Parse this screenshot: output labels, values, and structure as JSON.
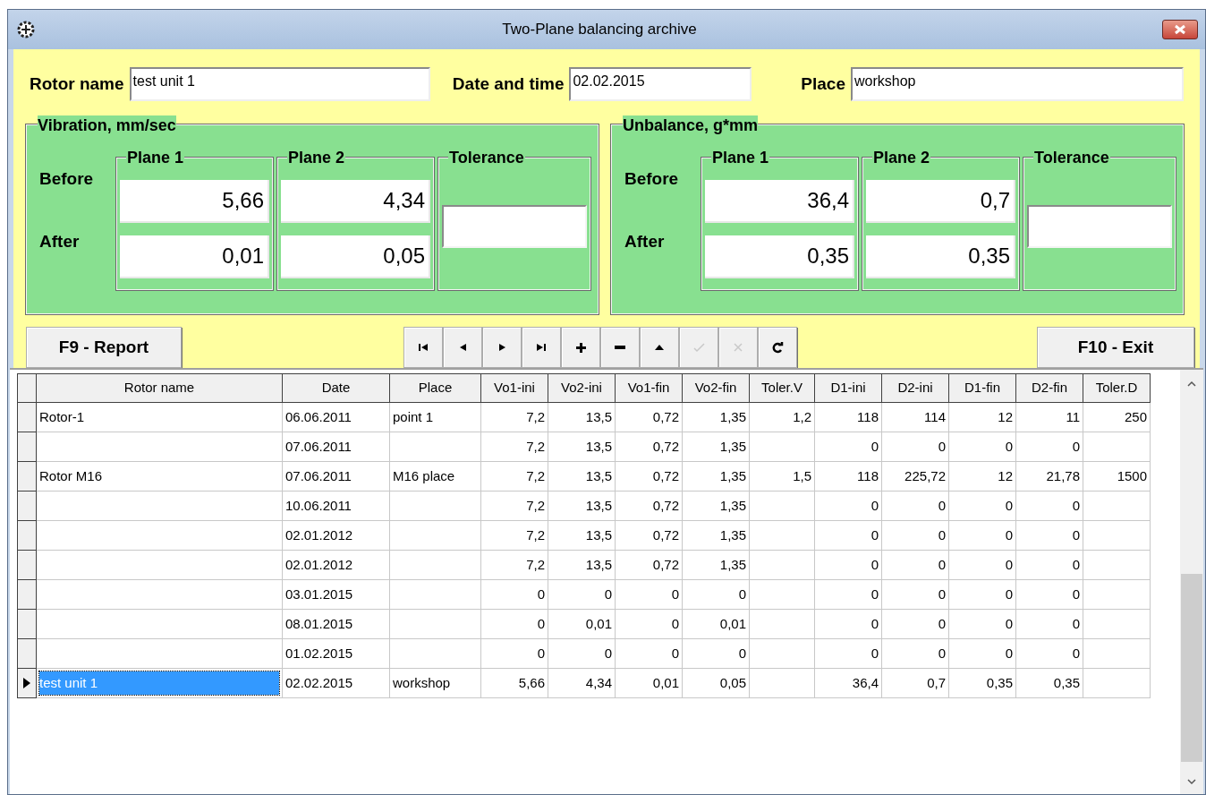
{
  "window": {
    "title": "Two-Plane balancing archive"
  },
  "header_fields": [
    {
      "label": "Rotor name",
      "value": "test unit 1"
    },
    {
      "label": "Date and time",
      "value": "02.02.2015"
    },
    {
      "label": "Place",
      "value": "workshop"
    }
  ],
  "groups": [
    {
      "title": "Vibration, mm/sec",
      "columns": [
        "Plane 1",
        "Plane 2",
        "Tolerance"
      ],
      "row_labels": [
        "Before",
        "After"
      ],
      "values": [
        [
          "5,66",
          "4,34"
        ],
        [
          "0,01",
          "0,05"
        ]
      ]
    },
    {
      "title": "Unbalance, g*mm",
      "columns": [
        "Plane 1",
        "Plane 2",
        "Tolerance"
      ],
      "row_labels": [
        "Before",
        "After"
      ],
      "values": [
        [
          "36,4",
          "0,7"
        ],
        [
          "0,35",
          "0,35"
        ]
      ]
    }
  ],
  "report_button": "F9 - Report",
  "exit_button": "F10 - Exit",
  "navigator": [
    {
      "kind": "first",
      "disabled": false
    },
    {
      "kind": "prior",
      "disabled": false
    },
    {
      "kind": "next",
      "disabled": false
    },
    {
      "kind": "last",
      "disabled": false
    },
    {
      "kind": "insert",
      "disabled": false
    },
    {
      "kind": "delete",
      "disabled": false
    },
    {
      "kind": "edit",
      "disabled": false
    },
    {
      "kind": "post",
      "disabled": true
    },
    {
      "kind": "cancel",
      "disabled": true
    },
    {
      "kind": "refresh",
      "disabled": false
    }
  ],
  "table": {
    "columns": [
      "Rotor name",
      "Date",
      "Place",
      "Vo1-ini",
      "Vo2-ini",
      "Vo1-fin",
      "Vo2-fin",
      "Toler.V",
      "D1-ini",
      "D2-ini",
      "D1-fin",
      "D2-fin",
      "Toler.D"
    ],
    "rows": [
      {
        "selected": false,
        "cells": [
          "Rotor-1",
          "06.06.2011",
          "point 1",
          "7,2",
          "13,5",
          "0,72",
          "1,35",
          "1,2",
          "118",
          "114",
          "12",
          "11",
          "250"
        ]
      },
      {
        "selected": false,
        "cells": [
          "",
          "07.06.2011",
          "",
          "7,2",
          "13,5",
          "0,72",
          "1,35",
          "",
          "0",
          "0",
          "0",
          "0",
          ""
        ]
      },
      {
        "selected": false,
        "cells": [
          "Rotor M16",
          "07.06.2011",
          "M16 place",
          "7,2",
          "13,5",
          "0,72",
          "1,35",
          "1,5",
          "118",
          "225,72",
          "12",
          "21,78",
          "1500"
        ]
      },
      {
        "selected": false,
        "cells": [
          "",
          "10.06.2011",
          "",
          "7,2",
          "13,5",
          "0,72",
          "1,35",
          "",
          "0",
          "0",
          "0",
          "0",
          ""
        ]
      },
      {
        "selected": false,
        "cells": [
          "",
          "02.01.2012",
          "",
          "7,2",
          "13,5",
          "0,72",
          "1,35",
          "",
          "0",
          "0",
          "0",
          "0",
          ""
        ]
      },
      {
        "selected": false,
        "cells": [
          "",
          "02.01.2012",
          "",
          "7,2",
          "13,5",
          "0,72",
          "1,35",
          "",
          "0",
          "0",
          "0",
          "0",
          ""
        ]
      },
      {
        "selected": false,
        "cells": [
          "",
          "03.01.2015",
          "",
          "0",
          "0",
          "0",
          "0",
          "",
          "0",
          "0",
          "0",
          "0",
          ""
        ]
      },
      {
        "selected": false,
        "cells": [
          "",
          "08.01.2015",
          "",
          "0",
          "0,01",
          "0",
          "0,01",
          "",
          "0",
          "0",
          "0",
          "0",
          ""
        ]
      },
      {
        "selected": false,
        "cells": [
          "",
          "01.02.2015",
          "",
          "0",
          "0",
          "0",
          "0",
          "",
          "0",
          "0",
          "0",
          "0",
          ""
        ]
      },
      {
        "selected": true,
        "cells": [
          "test unit 1",
          "02.02.2015",
          "workshop",
          "5,66",
          "4,34",
          "0,01",
          "0,05",
          "",
          "36,4",
          "0,7",
          "0,35",
          "0,35",
          ""
        ]
      }
    ]
  }
}
